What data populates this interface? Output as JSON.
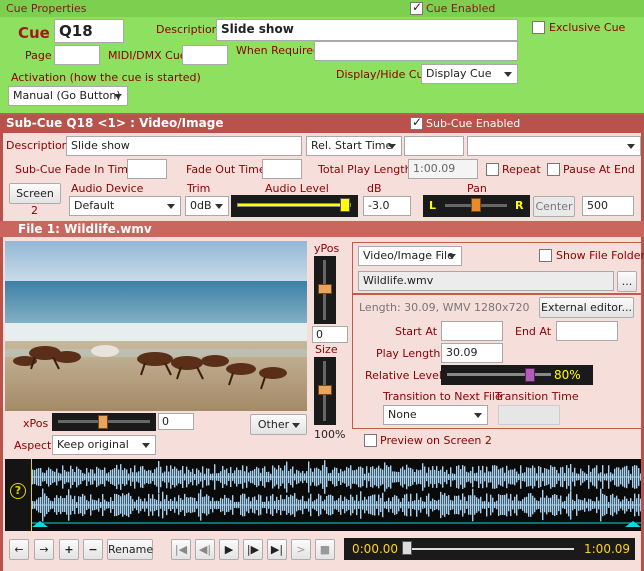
{
  "cue": {
    "section_title": "Cue Properties",
    "cue_enabled_label": "Cue Enabled",
    "cue_enabled": true,
    "cue_label": "Cue",
    "cue_number": "Q18",
    "description_label": "Description",
    "description": "Slide show",
    "exclusive_label": "Exclusive Cue",
    "exclusive": false,
    "page_label": "Page",
    "page_value": "",
    "midi_label": "MIDI/DMX Cue",
    "midi_value": "",
    "when_required_label": "When Required",
    "when_required_value": "",
    "activation_label": "Activation (how the cue is started)",
    "activation_value": "Manual (Go Button)",
    "display_hide_label": "Display/Hide Cue",
    "display_hide_value": "Display Cue"
  },
  "subcue": {
    "title": "Sub-Cue Q18 <1> : Video/Image",
    "enabled_label": "Sub-Cue Enabled",
    "enabled": true,
    "description_label": "Description",
    "description": "Slide show",
    "start_mode": "Rel. Start Time",
    "start_value": "",
    "extra_select": "",
    "fade_in_label": "Sub-Cue Fade In Time",
    "fade_in_value": "",
    "fade_out_label": "Fade Out Time",
    "fade_out_value": "",
    "total_length_label": "Total Play Length",
    "total_length_value": "1:00.09",
    "repeat_label": "Repeat",
    "pause_label": "Pause At End",
    "screen_button": "Screen",
    "screen_number": "2",
    "audio_device_label": "Audio Device",
    "audio_device_value": "Default",
    "trim_label": "Trim",
    "trim_value": "0dB",
    "audio_level_label": "Audio Level",
    "db_label": "dB",
    "db_value": "-3.0",
    "pan_label": "Pan",
    "pan_left": "L",
    "pan_right": "R",
    "center_button": "Center",
    "pan_value": "500",
    "audio_level_fraction": 0.95,
    "pan_fraction": 0.5
  },
  "file": {
    "title": "File 1: Wildlife.wmv",
    "ypos_label": "yPos",
    "ypos_value": "0",
    "size_label": "Size",
    "size_value": "100%",
    "xpos_label": "xPos",
    "xpos_value": "0",
    "other_button": "Other",
    "aspect_label": "Aspect",
    "aspect_value": "Keep original",
    "type_select": "Video/Image File",
    "show_folders_label": "Show File Folders",
    "filename": "Wildlife.wmv",
    "browse_button": "...",
    "length_info": "Length: 30.09, WMV 1280x720",
    "external_editor_button": "External editor...",
    "start_at_label": "Start At",
    "start_at_value": "",
    "end_at_label": "End At",
    "end_at_value": "",
    "play_length_label": "Play Length",
    "play_length_value": "30.09",
    "relative_level_label": "Relative Level",
    "relative_level_value": "80%",
    "relative_level_fraction": 0.8,
    "transition_label": "Transition to Next File",
    "transition_value": "None",
    "transition_time_label": "Transition Time",
    "transition_time_value": "",
    "preview_label": "Preview on Screen 2",
    "waveform_help": "?",
    "rename_button": "Rename",
    "time_start": "0:00.00",
    "time_end": "1:00.09"
  },
  "colors": {
    "cue_panel": "#8ee060",
    "subcue_bar": "#b8524a",
    "level_fill": "#ffff00",
    "relative_thumb": "#b45ab8"
  }
}
